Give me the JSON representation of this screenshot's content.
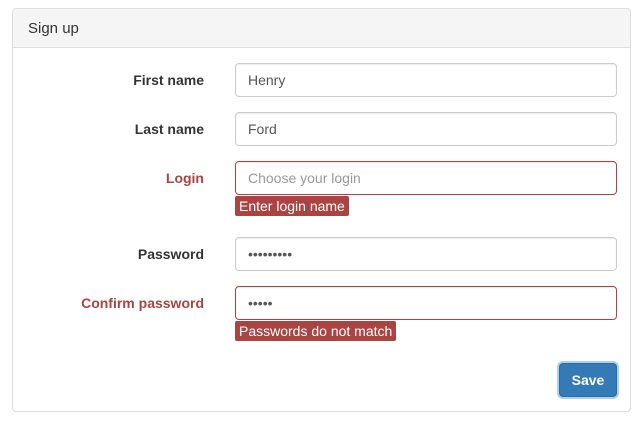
{
  "panel": {
    "title": "Sign up"
  },
  "form": {
    "first_name": {
      "label": "First name",
      "value": "Henry",
      "placeholder": ""
    },
    "last_name": {
      "label": "Last name",
      "value": "Ford",
      "placeholder": ""
    },
    "login": {
      "label": "Login",
      "value": "",
      "placeholder": "Choose your login",
      "error": "Enter login name"
    },
    "password": {
      "label": "Password",
      "value": "•••••••••",
      "type": "password"
    },
    "confirm_password": {
      "label": "Confirm password",
      "value": "•••••",
      "type": "password",
      "error": "Passwords do not match"
    },
    "save_label": "Save"
  },
  "colors": {
    "error": "#a94442",
    "primary": "#337ab7",
    "heading_bg": "#f5f5f5"
  }
}
